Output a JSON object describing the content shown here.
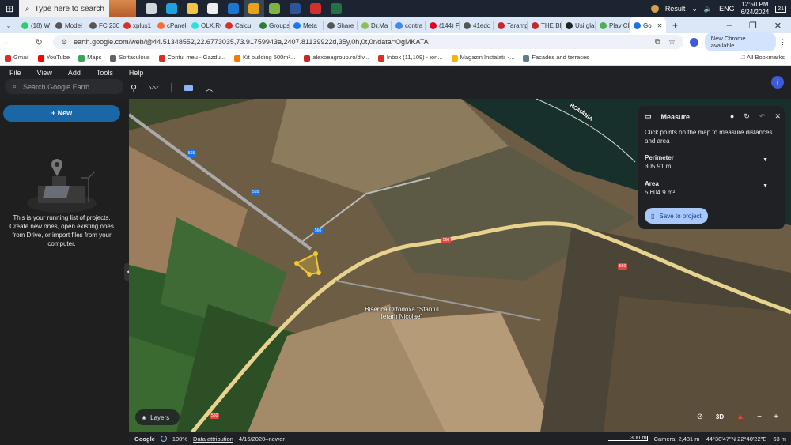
{
  "taskbar": {
    "search_placeholder": "Type here to search",
    "weather": "Result",
    "lang": "ENG",
    "time": "12:50 PM",
    "date": "6/24/2024",
    "notifications": "21",
    "apps": [
      {
        "icon": "task-view-icon",
        "color": "#cfd8dc"
      },
      {
        "icon": "edge-icon",
        "color": "#1fa1e0"
      },
      {
        "icon": "file-explorer-icon",
        "color": "#f4c542"
      },
      {
        "icon": "store-icon",
        "color": "#eeeeee"
      },
      {
        "icon": "mail-icon",
        "color": "#1976d2"
      },
      {
        "icon": "chrome-icon",
        "color": "#e8a317"
      },
      {
        "icon": "app-green-icon",
        "color": "#7cb342"
      },
      {
        "icon": "word-icon",
        "color": "#2b579a"
      },
      {
        "icon": "app-red-icon",
        "color": "#d32f2f"
      },
      {
        "icon": "excel-icon",
        "color": "#217346"
      }
    ]
  },
  "tabs": [
    {
      "label": "(18) W",
      "color": "#25d366"
    },
    {
      "label": "Model",
      "color": "#555"
    },
    {
      "label": "FC 230",
      "color": "#555"
    },
    {
      "label": "xplus1",
      "color": "#d93025"
    },
    {
      "label": "cPanel",
      "color": "#ff6c2c"
    },
    {
      "label": "OLX.RO",
      "color": "#23e5db"
    },
    {
      "label": "Calcul",
      "color": "#d93025"
    },
    {
      "label": "Groups",
      "color": "#2e7d32"
    },
    {
      "label": "Meta",
      "color": "#1877f2"
    },
    {
      "label": "Share",
      "color": "#555"
    },
    {
      "label": "Dr.Ma",
      "color": "#8bc34a"
    },
    {
      "label": "contra",
      "color": "#4285f4"
    },
    {
      "label": "(144) P",
      "color": "#e60023"
    },
    {
      "label": "41edc",
      "color": "#555"
    },
    {
      "label": "Taramp",
      "color": "#c62828"
    },
    {
      "label": "THE BI",
      "color": "#c62828"
    },
    {
      "label": "Usi gla",
      "color": "#222"
    },
    {
      "label": "Play Ch",
      "color": "#4caf50"
    },
    {
      "label": "Go",
      "color": "#1a73e8",
      "active": true
    }
  ],
  "address": {
    "url": "earth.google.com/web/@44.51348552,22.6773035,73.91759943a,2407.81139922d,35y,0h,0t,0r/data=OgMKATA",
    "new_chrome": "New Chrome available"
  },
  "bookmarks": [
    {
      "label": "Gmail",
      "color": "#d93025"
    },
    {
      "label": "YouTube",
      "color": "#ff0000"
    },
    {
      "label": "Maps",
      "color": "#34a853"
    },
    {
      "label": "Softaculous",
      "color": "#5f6368"
    },
    {
      "label": "Contul meu - Gazdu...",
      "color": "#d93025"
    },
    {
      "label": "Kit building 500m²...",
      "color": "#f57c00"
    },
    {
      "label": "alexbeagroup.ro/div...",
      "color": "#c62828"
    },
    {
      "label": "Inbox (11,109) - ion...",
      "color": "#d93025"
    },
    {
      "label": "Magazin Instalatii -...",
      "color": "#f4b400"
    },
    {
      "label": "Facades and terraces",
      "color": "#607d8b"
    }
  ],
  "all_bookmarks": "All Bookmarks",
  "app": {
    "menu": [
      "File",
      "View",
      "Add",
      "Tools",
      "Help"
    ],
    "search_placeholder": "Search Google Earth",
    "avatar": "i",
    "new_label": "New",
    "empty_text": "This is your running list of projects. Create new ones, open existing ones from Drive, or import files from your computer."
  },
  "measure": {
    "title": "Measure",
    "description": "Click points on the map to measure distances and area",
    "perimeter_label": "Perimeter",
    "perimeter_value": "305.91 m",
    "area_label": "Area",
    "area_value": "5,604.9 m²",
    "save_label": "Save to project"
  },
  "map": {
    "labels": {
      "country": "ROMÂNIA",
      "church": "Biserica Ortodoxă \"Sfântul Ierarh Nicolae\"",
      "road565": "565",
      "road560": "560"
    },
    "layers_label": "Layers",
    "btn_3d": "3D"
  },
  "status": {
    "brand": "Google",
    "zoom": "100%",
    "attribution": "Data attribution",
    "imagery_date": "4/16/2020–newer",
    "scale": "300 m",
    "camera": "Camera: 2,481 m",
    "coords": "44°30'47\"N 22°40'22\"E",
    "elevation": "63 m"
  }
}
